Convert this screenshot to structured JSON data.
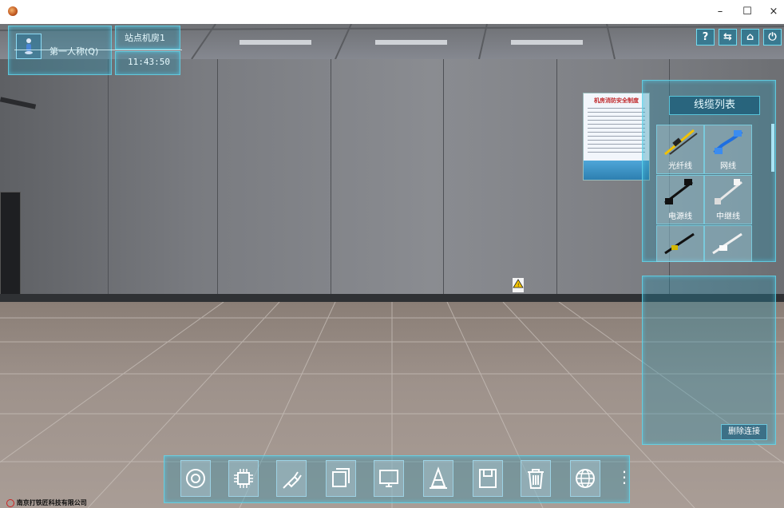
{
  "window": {
    "minimize_glyph": "–",
    "maximize_glyph": "☐",
    "close_glyph": "×"
  },
  "hud": {
    "view_mode": "第一人称(Q)",
    "location": "站点机房1",
    "time": "11:43:50"
  },
  "top_buttons": {
    "help": "?",
    "switch": "⇆",
    "home": "⌂",
    "power": "⏻"
  },
  "poster": {
    "title": "机房消防安全制度"
  },
  "cable_list": {
    "title": "线缆列表",
    "items": [
      {
        "label": "光纤线",
        "icon": "fiber-cable-icon"
      },
      {
        "label": "网线",
        "icon": "network-cable-icon"
      },
      {
        "label": "电源线",
        "icon": "power-cable-icon"
      },
      {
        "label": "中继线",
        "icon": "trunk-cable-icon"
      },
      {
        "label": "",
        "icon": "cable-icon"
      },
      {
        "label": "",
        "icon": "rj45-cable-icon"
      }
    ]
  },
  "connection_panel": {
    "delete_label": "删除连接"
  },
  "toolbar": {
    "icons": [
      "lifebuoy-icon",
      "chip-icon",
      "plug-icon",
      "copy-icon",
      "monitor-icon",
      "cone-icon",
      "save-icon",
      "trash-icon",
      "globe-icon"
    ],
    "more_glyph": "⋮"
  },
  "branding": {
    "company": "南京打铁匠科技有限公司"
  },
  "colors": {
    "hud_accent": "#5fd8f0",
    "hud_fill": "#2a8fae"
  }
}
